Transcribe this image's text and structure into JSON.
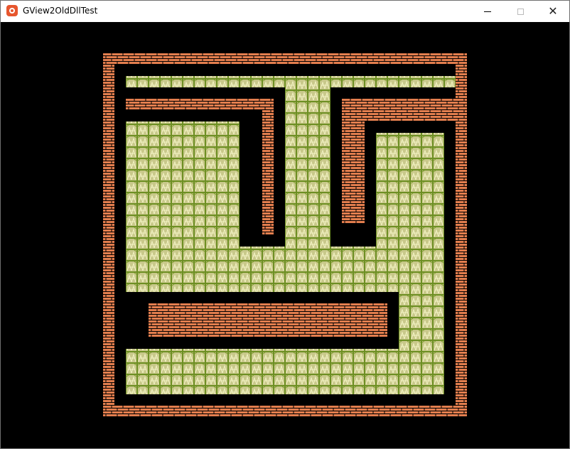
{
  "window": {
    "title": "GView2OldDllTest",
    "controls": {
      "minimize": "minimize",
      "maximize": "maximize",
      "close": "✕"
    }
  },
  "colors": {
    "background": "#000000",
    "brick": "#e37e4e",
    "mortar": "#000000",
    "grass_fill": "#d9d9a0",
    "grass_line": "#7a9a28"
  },
  "scene": {
    "description_icon": "brick-and-grass tile map"
  }
}
